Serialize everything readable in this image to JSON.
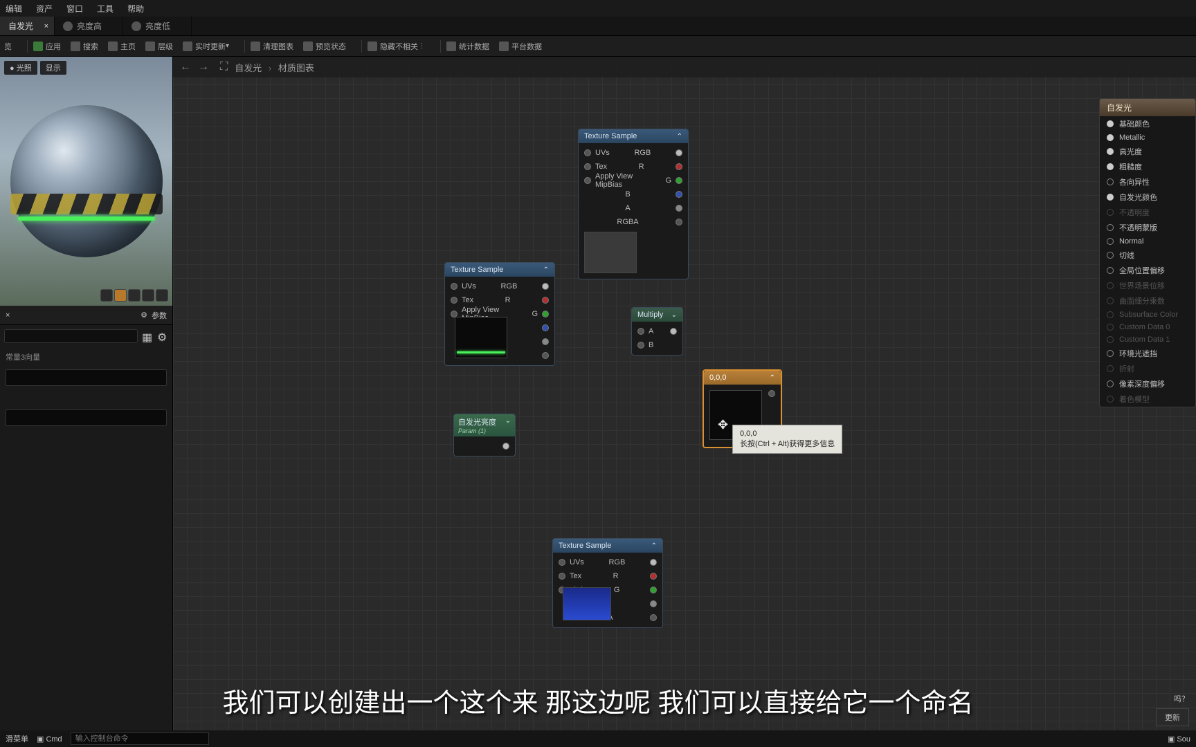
{
  "menu": {
    "edit": "编辑",
    "asset": "资产",
    "window": "窗口",
    "tool": "工具",
    "help": "帮助"
  },
  "tabs": {
    "t1": "自发光",
    "t2": "亮度高",
    "t3": "亮度低"
  },
  "toolbar": {
    "preview": "览",
    "apply": "应用",
    "search": "搜索",
    "home": "主页",
    "level": "层级",
    "live": "实时更新",
    "clean": "清理图表",
    "prevstate": "预览状态",
    "hide": "隐藏不相关",
    "stats": "统计数据",
    "platdata": "平台数据"
  },
  "viewport": {
    "lighting": "光照",
    "display": "显示"
  },
  "params": {
    "title": "参数",
    "group": "常量3向量"
  },
  "graph": {
    "crumb1": "自发光",
    "crumb2": "材质图表"
  },
  "nodes": {
    "tex_sample": "Texture Sample",
    "multiply": "Multiply",
    "param_name": "自发光亮度",
    "param_sub": "Param (1)",
    "const3": "0,0,0",
    "uvs": "UVs",
    "tex": "Tex",
    "mip": "Apply View MipBias",
    "rgb": "RGB",
    "r": "R",
    "g": "G",
    "b": "B",
    "a": "A",
    "rgba": "RGBA",
    "pa": "A",
    "pb": "B"
  },
  "tooltip": {
    "l1": "0,0,0",
    "l2": "长按(Ctrl + Alt)获得更多信息"
  },
  "result": {
    "title": "自发光",
    "pins": {
      "base": "基础颜色",
      "metallic": "Metallic",
      "specular": "高光度",
      "rough": "粗糙度",
      "aniso": "各向异性",
      "emissive": "自发光颜色",
      "opacity": "不透明度",
      "mask": "不透明蒙版",
      "normal": "Normal",
      "tangent": "切线",
      "worldpos": "全局位置偏移",
      "wdisp": "世界场景位移",
      "tess": "曲面细分乘数",
      "subsurf": "Subsurface Color",
      "cd0": "Custom Data 0",
      "cd1": "Custom Data 1",
      "ao": "环境光遮挡",
      "refract": "折射",
      "pixdepth": "像素深度偏移",
      "shading": "着色模型"
    }
  },
  "bottom": {
    "menu": "滑菜单",
    "cmd": "Cmd",
    "cmd_ph": "输入控制台命令",
    "sou": "Sou",
    "q": "吗？",
    "update": "更新"
  },
  "subtitle": "我们可以创建出一个这个来 那这边呢 我们可以直接给它一个命名"
}
